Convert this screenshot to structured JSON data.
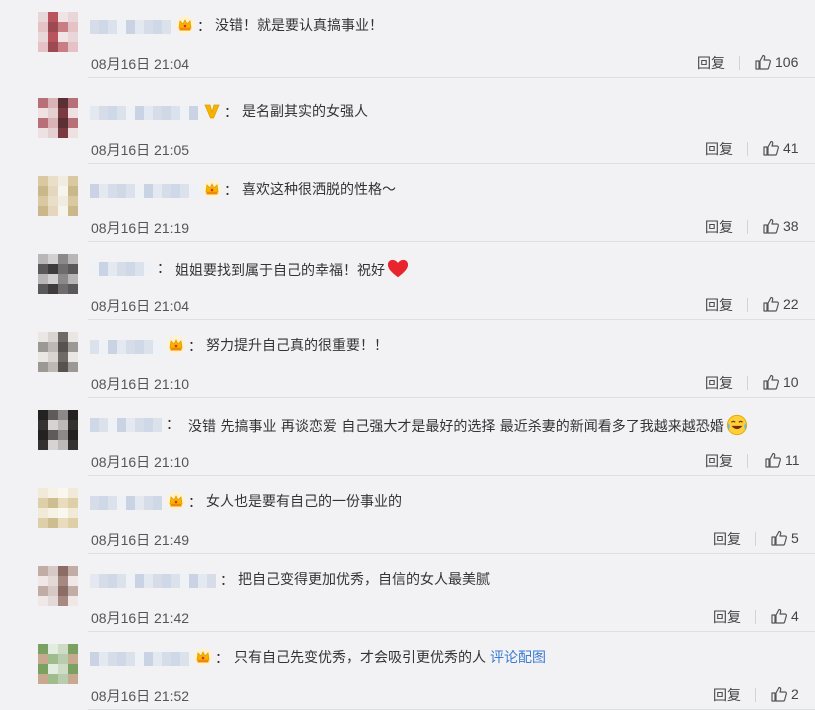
{
  "comments": [
    {
      "text": "没错！就是要认真搞事业！",
      "time": "08月16日 21:04",
      "reply": "回复",
      "likes": "106",
      "badge": "crown-icon",
      "link": ""
    },
    {
      "text": "是名副其实的女强人",
      "time": "08月16日 21:05",
      "reply": "回复",
      "likes": "41",
      "badge": "verified-v-icon",
      "link": ""
    },
    {
      "text": "喜欢这种很洒脱的性格～",
      "time": "08月16日 21:19",
      "reply": "回复",
      "likes": "38",
      "badge": "crown-icon",
      "link": ""
    },
    {
      "text": "姐姐要找到属于自己的幸福！祝好",
      "time": "08月16日 21:04",
      "reply": "回复",
      "likes": "22",
      "badge": "",
      "emoji": "heart-emoji-icon",
      "link": ""
    },
    {
      "text": "努力提升自己真的很重要！！",
      "time": "08月16日 21:10",
      "reply": "回复",
      "likes": "10",
      "badge": "crown-icon",
      "link": ""
    },
    {
      "text": "没错 先搞事业 再谈恋爱 自己强大才是最好的选择 最近杀妻的新闻看多了我越来越恐婚",
      "time": "08月16日 21:10",
      "reply": "回复",
      "likes": "11",
      "badge": "",
      "emoji": "laughing-crying-emoji-icon",
      "link": ""
    },
    {
      "text": "女人也是要有自己的一份事业的",
      "time": "08月16日 21:49",
      "reply": "回复",
      "likes": "5",
      "badge": "crown-icon",
      "link": ""
    },
    {
      "text": "把自己变得更加优秀，自信的女人最美腻",
      "time": "08月16日 21:42",
      "reply": "回复",
      "likes": "4",
      "badge": "",
      "link": ""
    },
    {
      "text": "只有自己先变优秀，才会吸引更优秀的人",
      "time": "08月16日 21:52",
      "reply": "回复",
      "likes": "2",
      "badge": "crown-icon",
      "link": "评论配图"
    }
  ],
  "colors": {
    "background": "#f2f2f5",
    "link": "#3b7bd1",
    "crown_gold": "#f5b400",
    "heart_red": "#e8242c"
  }
}
